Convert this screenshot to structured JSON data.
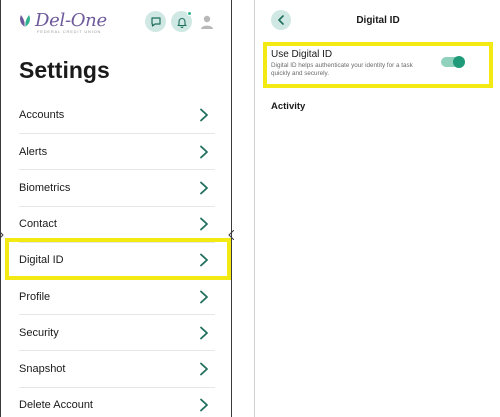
{
  "settings_screen": {
    "logo": {
      "name": "Del-One",
      "tagline": "FEDERAL CREDIT UNION"
    },
    "icons": {
      "messages": "chat-icon",
      "notifications": "bell-icon",
      "profile": "user-icon"
    },
    "title": "Settings",
    "menu_items": [
      {
        "label": "Accounts"
      },
      {
        "label": "Alerts"
      },
      {
        "label": "Biometrics"
      },
      {
        "label": "Contact"
      },
      {
        "label": "Digital ID"
      },
      {
        "label": "Profile"
      },
      {
        "label": "Security"
      },
      {
        "label": "Snapshot"
      },
      {
        "label": "Delete Account"
      }
    ],
    "highlighted_item": "Digital ID"
  },
  "digital_id_screen": {
    "title": "Digital ID",
    "back_icon": "chevron-left-icon",
    "use_digital_id": {
      "label": "Use Digital ID",
      "description": "Digital ID helps authenticate your identity for a task quickly and securely.",
      "enabled": true
    },
    "activity_heading": "Activity"
  },
  "colors": {
    "highlight": "#f2ea12",
    "accent": "#1f9b7a",
    "accent_light": "#cfe8e3",
    "brand_purple": "#6e5a9b"
  }
}
